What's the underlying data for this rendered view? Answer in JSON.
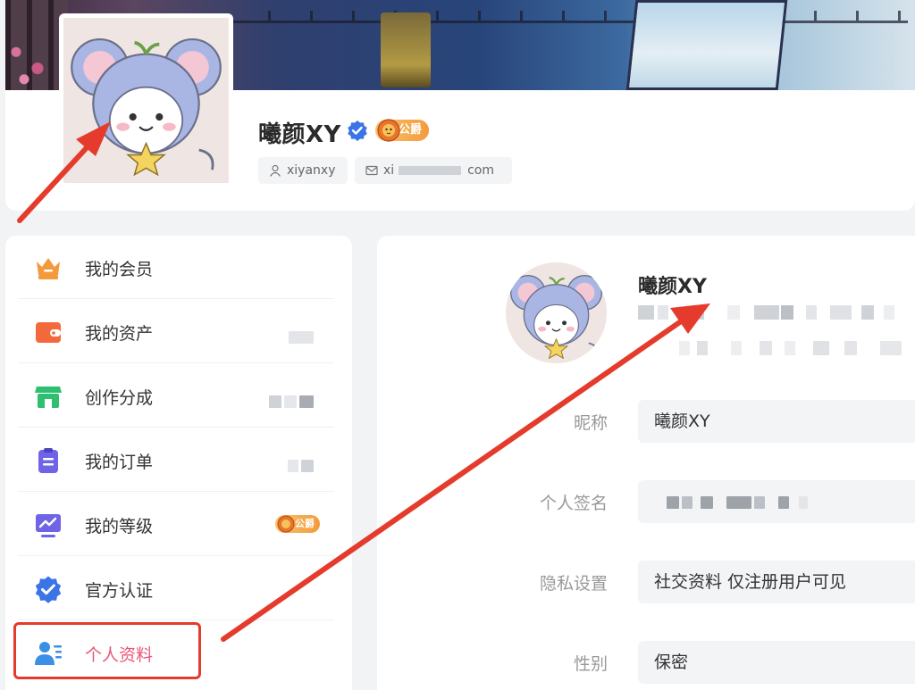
{
  "profile": {
    "name": "曦颜XY",
    "rank": "公爵",
    "username": "xiyanxy",
    "email_visible": "xi",
    "email_suffix": "com"
  },
  "sidebar": {
    "items": [
      {
        "label": "我的会员",
        "icon": "crown-icon"
      },
      {
        "label": "我的资产",
        "icon": "wallet-icon"
      },
      {
        "label": "创作分成",
        "icon": "shop-icon"
      },
      {
        "label": "我的订单",
        "icon": "clipboard-icon"
      },
      {
        "label": "我的等级",
        "icon": "level-chart-icon",
        "badge": "公爵"
      },
      {
        "label": "官方认证",
        "icon": "verified-shield-icon"
      },
      {
        "label": "个人资料",
        "icon": "user-profile-icon",
        "active": true
      }
    ]
  },
  "content": {
    "name": "曦颜XY",
    "fields": [
      {
        "label": "昵称",
        "value": "曦颜XY"
      },
      {
        "label": "个人签名",
        "value": ""
      },
      {
        "label": "隐私设置",
        "value": "社交资料 仅注册用户可见"
      },
      {
        "label": "性别",
        "value": "保密"
      }
    ]
  },
  "colors": {
    "accent": "#e8577a",
    "verified_blue": "#3b74e6",
    "rank_gold": "#f39b3b",
    "annotation_red": "#e53b2c"
  }
}
